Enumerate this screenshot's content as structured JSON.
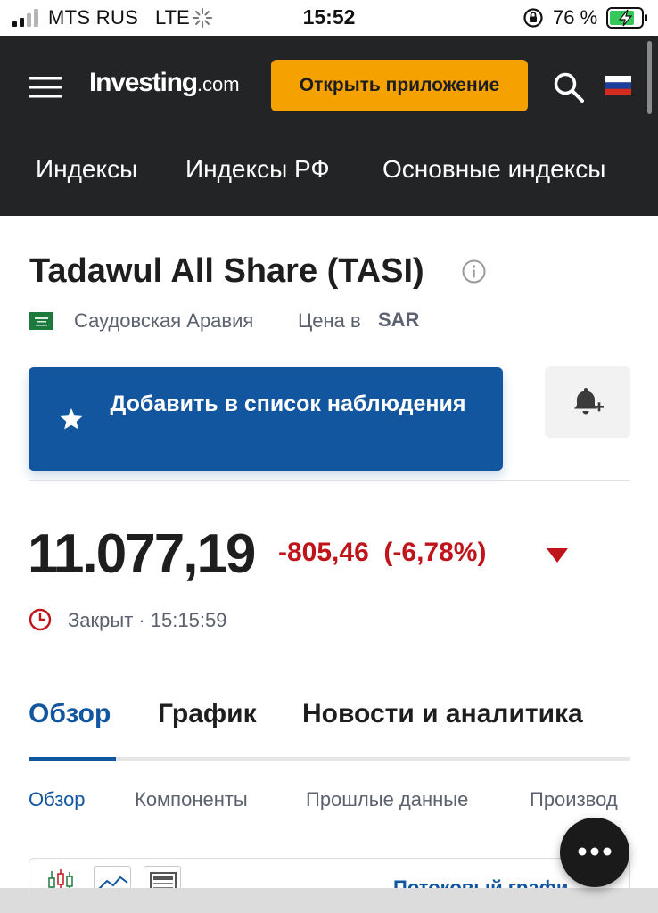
{
  "status_bar": {
    "carrier": "MTS RUS",
    "network": "LTE",
    "time": "15:52",
    "battery_percent": "76 %"
  },
  "header": {
    "logo_text": "Investing",
    "logo_suffix": ".com",
    "open_app_label": "Открыть приложение",
    "nav": [
      "Индексы",
      "Индексы РФ",
      "Основные индексы"
    ],
    "icons": [
      "menu-icon",
      "search-icon",
      "russia-flag-icon"
    ]
  },
  "instrument": {
    "title": "Tadawul All Share (TASI)",
    "country": "Саудовская Аравия",
    "price_in_label": "Цена в",
    "currency": "SAR",
    "watchlist_button": "Добавить в список наблюдения",
    "price": "11.077,19",
    "change": "-805,46",
    "change_percent": "(-6,78%)",
    "market_status": "Закрыт · 15:15:59",
    "change_color": "#c0141b"
  },
  "tabs": [
    "Обзор",
    "График",
    "Новости и аналитика"
  ],
  "subtabs": [
    "Обзор",
    "Компоненты",
    "Прошлые данные",
    "Производ"
  ],
  "chart_card": {
    "stream_link": "Потоковый графи"
  },
  "colors": {
    "accent": "#1256a0",
    "header_bg": "#232425",
    "open_app_bg": "#f5a100",
    "negative": "#c0141b"
  }
}
